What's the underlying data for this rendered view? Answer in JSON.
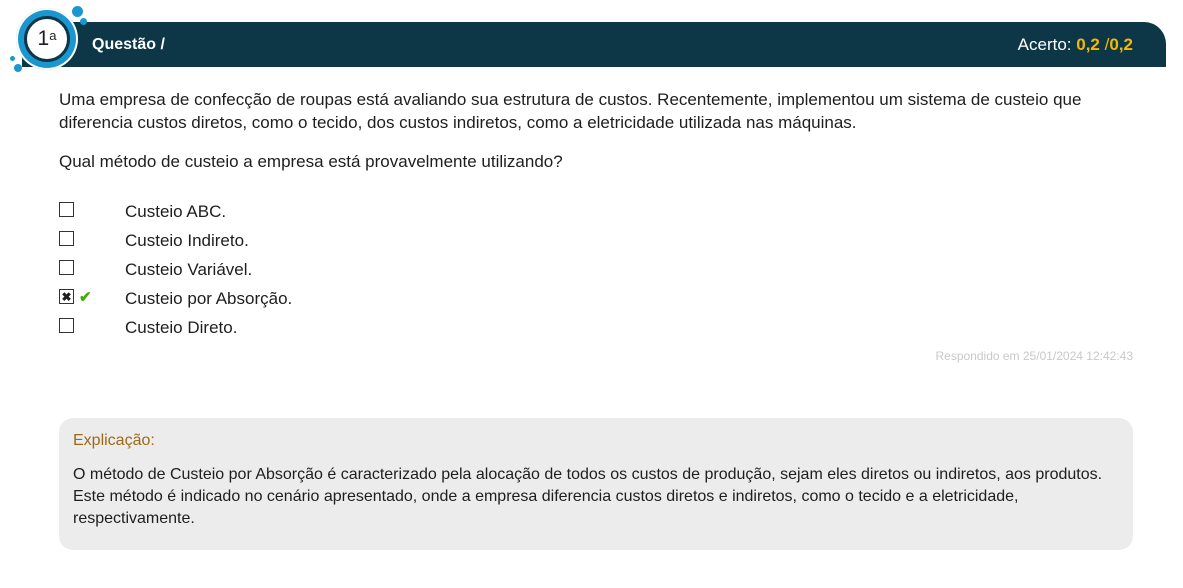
{
  "header": {
    "number": "1",
    "number_suffix": "a",
    "title": "Questão  /",
    "score_label": "Acerto:",
    "score_value": "0,2",
    "score_separator": "/",
    "score_max": "0,2"
  },
  "question": {
    "text": "Uma empresa de confecção de roupas está avaliando sua estrutura de custos. Recentemente, implementou um sistema de custeio que diferencia custos diretos, como o tecido, dos custos indiretos, como a eletricidade utilizada nas máquinas.",
    "prompt": "Qual método de custeio a empresa está provavelmente utilizando?",
    "options": [
      {
        "label": "Custeio ABC.",
        "checked": false,
        "correct": false
      },
      {
        "label": "Custeio Indireto.",
        "checked": false,
        "correct": false
      },
      {
        "label": "Custeio Variável.",
        "checked": false,
        "correct": false
      },
      {
        "label": "Custeio por Absorção.",
        "checked": true,
        "correct": true
      },
      {
        "label": "Custeio Direto.",
        "checked": false,
        "correct": false
      }
    ],
    "answered_at": "Respondido em 25/01/2024 12:42:43"
  },
  "explanation": {
    "title": "Explicação:",
    "text": "O método de Custeio por Absorção é caracterizado pela alocação de todos os custos de produção, sejam eles diretos ou indiretos, aos produtos. Este método é indicado no cenário apresentado, onde a empresa diferencia custos diretos e indiretos, como o tecido e a eletricidade, respectivamente."
  },
  "colors": {
    "header_bg": "#0d3747",
    "badge_blue": "#1a97d1",
    "score_accent": "#f5b800",
    "correct_green": "#3bb000",
    "explanation_title": "#9a6a18"
  },
  "icons": {
    "checked_box": "✖",
    "correct_mark": "✔"
  }
}
